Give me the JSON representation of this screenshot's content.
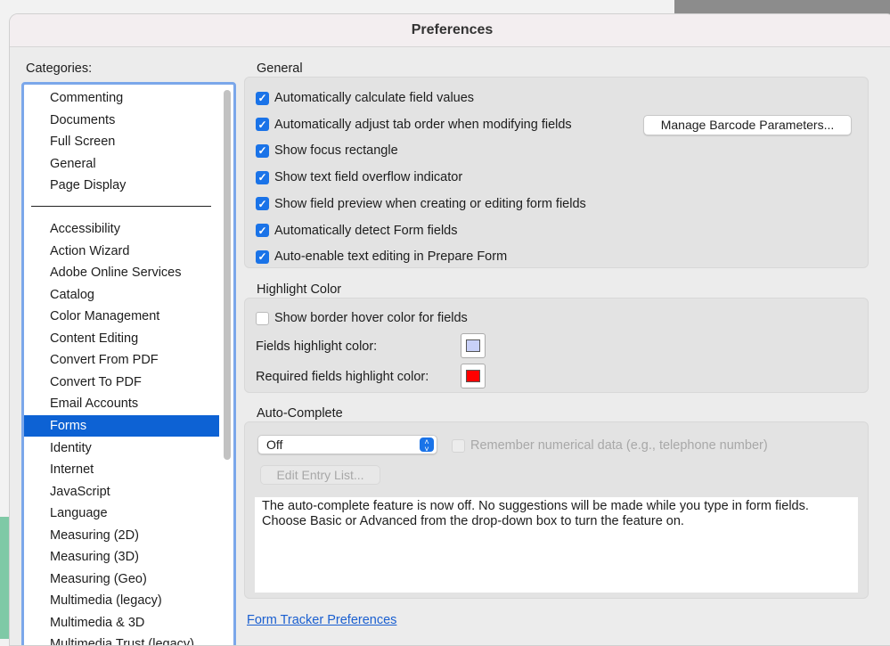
{
  "window": {
    "title": "Preferences"
  },
  "categories": {
    "label": "Categories:",
    "top_items": [
      "Commenting",
      "Documents",
      "Full Screen",
      "General",
      "Page Display"
    ],
    "items": [
      "Accessibility",
      "Action Wizard",
      "Adobe Online Services",
      "Catalog",
      "Color Management",
      "Content Editing",
      "Convert From PDF",
      "Convert To PDF",
      "Email Accounts",
      "Forms",
      "Identity",
      "Internet",
      "JavaScript",
      "Language",
      "Measuring (2D)",
      "Measuring (3D)",
      "Measuring (Geo)",
      "Multimedia (legacy)",
      "Multimedia & 3D",
      "Multimedia Trust (legacy)"
    ],
    "selected": "Forms"
  },
  "general": {
    "label": "General",
    "checkboxes": [
      {
        "label": "Automatically calculate field values",
        "checked": true
      },
      {
        "label": "Automatically adjust tab order when modifying fields",
        "checked": true
      },
      {
        "label": "Show focus rectangle",
        "checked": true
      },
      {
        "label": "Show text field overflow indicator",
        "checked": true
      },
      {
        "label": "Show field preview when creating or editing form fields",
        "checked": true
      },
      {
        "label": "Automatically detect Form fields",
        "checked": true
      },
      {
        "label": "Auto-enable text editing in Prepare Form",
        "checked": true
      }
    ],
    "barcode_button": "Manage Barcode Parameters..."
  },
  "highlight": {
    "label": "Highlight Color",
    "border_hover": {
      "label": "Show border hover color for fields",
      "checked": false
    },
    "fields_label": "Fields highlight color:",
    "fields_color": "#c8d0f8",
    "required_label": "Required fields highlight color:",
    "required_color": "#ff0000"
  },
  "autocomplete": {
    "label": "Auto-Complete",
    "select_value": "Off",
    "remember": {
      "label": "Remember numerical data (e.g., telephone number)",
      "checked": false
    },
    "edit_button": "Edit Entry List...",
    "description": "The auto-complete feature is now off. No suggestions will be made while you type in form fields. Choose Basic or Advanced from the drop-down box to turn the feature on."
  },
  "link": "Form Tracker Preferences"
}
